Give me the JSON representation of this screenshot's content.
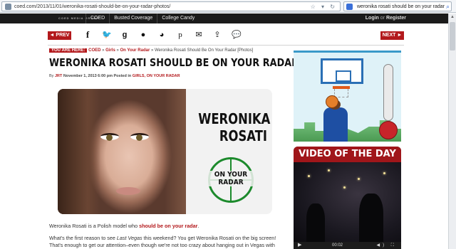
{
  "browser": {
    "url": "coed.com/2013/11/01/weronika-rosati-should-be-on-your-radar-photos/",
    "search_value": "weronika rosati should be on your radar"
  },
  "topnav": {
    "brand": "COED MEDIA GROUP",
    "links": [
      "COED",
      "Busted Coverage",
      "College Candy"
    ],
    "login": "Login",
    "separator": "or",
    "register": "Register"
  },
  "sharebar": {
    "prev": "◄ PREV",
    "next": "NEXT ►",
    "icons": [
      "facebook-icon",
      "twitter-icon",
      "google-plus-icon",
      "stumbleupon-icon",
      "reddit-icon",
      "pinterest-icon",
      "email-icon",
      "share-icon",
      "comment-icon"
    ]
  },
  "breadcrumb": {
    "here": "YOU ARE HERE:",
    "items": [
      "COED",
      "Girls",
      "On Your Radar"
    ],
    "current": "Weronika Rosati Should Be On Your Radar [Photos]"
  },
  "article": {
    "title": "WERONIKA ROSATI SHOULD BE ON YOUR RADAR [PHOTOS]",
    "by": "By",
    "author": "JRT",
    "date": "November 1, 2013 6:00 pm",
    "posted_in": "Posted in",
    "categories": "GIRLS, ON YOUR RADAR",
    "image_name_line1": "WERONIKA",
    "image_name_line2": "ROSATI",
    "image_badge_line1": "ON YOUR",
    "image_badge_line2": "RADAR",
    "p1_start": "Weronika Rosati is a Polish model who ",
    "p1_bold": "should be on your radar",
    "p1_end": ".",
    "p2_a": "What's the first reason to see ",
    "p2_italic": "Last Vegas",
    "p2_b": " this weekend? You get Weronika Rosati on the big screen! That's enough to get our attention–even though we're not too crazy about hanging out in Vegas with"
  },
  "sidebar": {
    "video_title": "VIDEO OF THE DAY",
    "video_time": "00:02"
  }
}
